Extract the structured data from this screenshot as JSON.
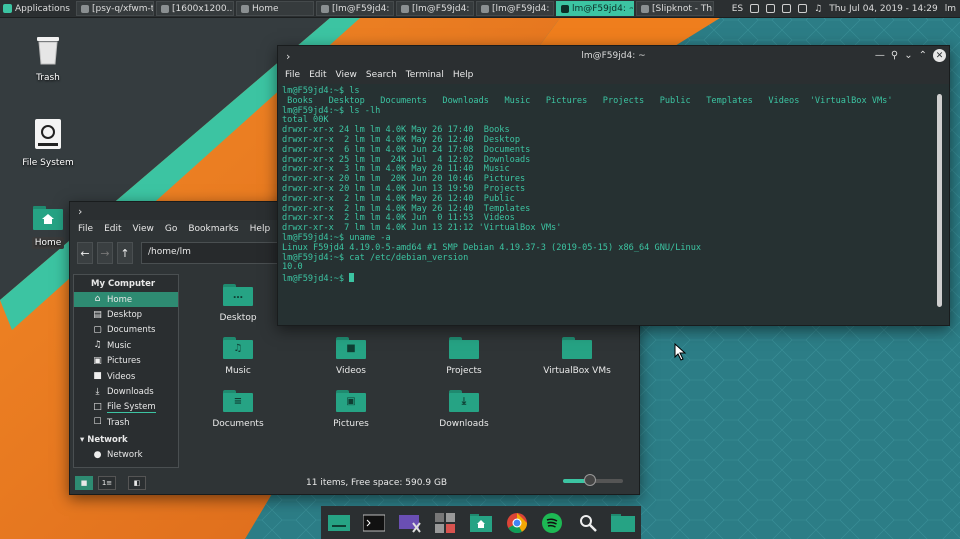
{
  "panel": {
    "applications": "Applications",
    "tasks": [
      {
        "label": "[psy-q/xfwm-t..."
      },
      {
        "label": "[1600x1200..."
      },
      {
        "label": "Home"
      },
      {
        "label": "[lm@F59jd4: ..."
      },
      {
        "label": "[lm@F59jd4: ~]"
      },
      {
        "label": "[lm@F59jd4: ..."
      },
      {
        "label": "lm@F59jd4: ~",
        "active": true
      },
      {
        "label": "[Slipknot - Th..."
      }
    ],
    "keyboard_layout": "ES",
    "clock": "Thu Jul 04, 2019 - 14:29",
    "user": "lm"
  },
  "desktop": {
    "icons": [
      {
        "label": "Trash"
      },
      {
        "label": "File System"
      },
      {
        "label": "Home"
      }
    ]
  },
  "file_manager": {
    "menu": [
      "File",
      "Edit",
      "View",
      "Go",
      "Bookmarks",
      "Help"
    ],
    "path": "/home/lm",
    "sidebar": {
      "section_computer": "My Computer",
      "computer_items": [
        {
          "label": "Home",
          "icon": "home-icon"
        },
        {
          "label": "Desktop",
          "icon": "desktop-icon"
        },
        {
          "label": "Documents",
          "icon": "document-icon"
        },
        {
          "label": "Music",
          "icon": "music-icon"
        },
        {
          "label": "Pictures",
          "icon": "picture-icon"
        },
        {
          "label": "Videos",
          "icon": "video-icon"
        },
        {
          "label": "Downloads",
          "icon": "download-icon"
        },
        {
          "label": "File System",
          "icon": "drive-icon"
        },
        {
          "label": "Trash",
          "icon": "trash-icon"
        }
      ],
      "section_network": "Network",
      "network_items": [
        {
          "label": "Network",
          "icon": "network-icon"
        }
      ]
    },
    "folders": [
      {
        "label": "Desktop",
        "glyph": "…"
      },
      {
        "label": "Music",
        "glyph": "♫"
      },
      {
        "label": "Videos",
        "glyph": "■"
      },
      {
        "label": "Projects",
        "glyph": ""
      },
      {
        "label": "VirtualBox VMs",
        "glyph": ""
      },
      {
        "label": "Documents",
        "glyph": "≡"
      },
      {
        "label": "Pictures",
        "glyph": "▣"
      },
      {
        "label": "Downloads",
        "glyph": "⤓"
      }
    ],
    "status": "11 items, Free space: 590.9 GB",
    "zoom_fraction": 0.45
  },
  "terminal": {
    "title": "lm@F59jd4: ~",
    "menu": [
      "File",
      "Edit",
      "View",
      "Search",
      "Terminal",
      "Help"
    ],
    "lines": [
      "lm@F59jd4:~$ ls",
      " Books   Desktop   Documents   Downloads   Music   Pictures   Projects   Public   Templates   Videos  'VirtualBox VMs'",
      "lm@F59jd4:~$ ls -lh",
      "total 00K",
      "drwxr-xr-x 24 lm lm 4.0K May 26 17:40  Books",
      "drwxr-xr-x  2 lm lm 4.0K May 26 12:40  Desktop",
      "drwxr-xr-x  6 lm lm 4.0K Jun 24 17:08  Documents",
      "drwxr-xr-x 25 lm lm  24K Jul  4 12:02  Downloads",
      "drwxr-xr-x  3 lm lm 4.0K May 20 11:40  Music",
      "drwxr-xr-x 20 lm lm  20K Jun 20 10:46  Pictures",
      "drwxr-xr-x 20 lm lm 4.0K Jun 13 19:50  Projects",
      "drwxr-xr-x  2 lm lm 4.0K May 26 12:40  Public",
      "drwxr-xr-x  2 lm lm 4.0K May 26 12:40  Templates",
      "drwxr-xr-x  2 lm lm 4.0K Jun  0 11:53  Videos",
      "drwxr-xr-x  7 lm lm 4.0K Jun 13 21:12 'VirtualBox VMs'",
      "lm@F59jd4:~$ uname -a",
      "Linux F59jd4 4.19.0-5-amd64 #1 SMP Debian 4.19.37-3 (2019-05-15) x86_64 GNU/Linux",
      "lm@F59jd4:~$ cat /etc/debian_version",
      "10.0"
    ],
    "prompt": "lm@F59jd4:~$ "
  },
  "dock": {
    "items": [
      {
        "icon": "show-desktop-icon"
      },
      {
        "icon": "terminal-icon"
      },
      {
        "icon": "screenshot-icon"
      },
      {
        "icon": "calculator-icon"
      },
      {
        "icon": "home-folder-icon"
      },
      {
        "icon": "chrome-icon"
      },
      {
        "icon": "spotify-icon"
      },
      {
        "icon": "search-icon"
      },
      {
        "icon": "files-icon"
      }
    ]
  },
  "colors": {
    "accent": "#3cc4a2",
    "orange": "#ef7e1d",
    "wallpaper_teal": "#2c7d86"
  }
}
